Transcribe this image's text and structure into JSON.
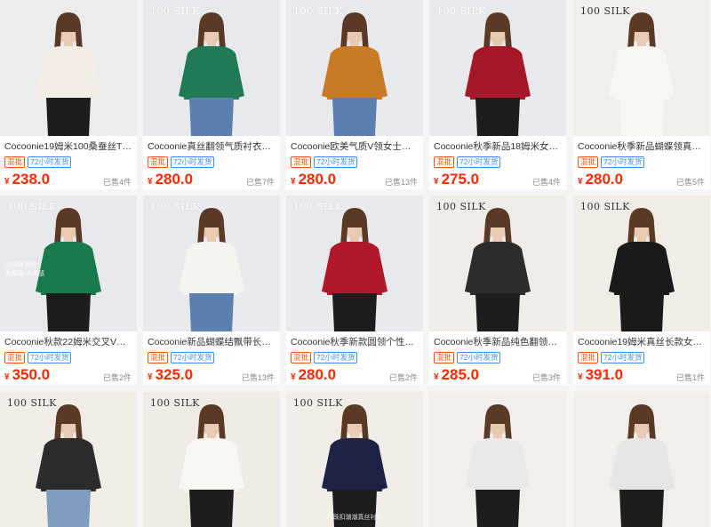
{
  "colors": {
    "price": "#ff2800",
    "mix_badge": "#ff5000",
    "ship_badge": "#3a8df5"
  },
  "products": [
    {
      "brand": "",
      "title": "Cocoonie19姆米100桑蚕丝T恤...",
      "mix": "混批",
      "ship": "72小时发货",
      "currency": "¥",
      "price": "238.0",
      "sold": "已售4件",
      "shirt_color": "#f3ede4",
      "bg": "#ececec",
      "pants": "#1d1d1d"
    },
    {
      "brand": "100 SILK",
      "title": "Cocoonie真丝翻领气质衬衣女批...",
      "mix": "混批",
      "ship": "72小时发货",
      "currency": "¥",
      "price": "280.0",
      "sold": "已售7件",
      "shirt_color": "#1f7a55",
      "bg": "#e8e9ec",
      "pants": "#5b7fae"
    },
    {
      "brand": "100 SILK",
      "title": "Cocoonie欧美气质V领女士衬衣...",
      "mix": "混批",
      "ship": "72小时发货",
      "currency": "¥",
      "price": "280.0",
      "sold": "已售13件",
      "shirt_color": "#c87a25",
      "bg": "#e8e9ec",
      "pants": "#5b7fae"
    },
    {
      "brand": "100 SILK",
      "title": "Cocoonie秋季新品18姆米女士...",
      "mix": "混批",
      "ship": "72小时发货",
      "currency": "¥",
      "price": "275.0",
      "sold": "已售4件",
      "shirt_color": "#a4182a",
      "bg": "#e8e9ec",
      "pants": "#1d1d1d"
    },
    {
      "brand": "100 SILK",
      "title": "Cocoonie秋季新品蝴蝶领真丝衬...",
      "mix": "混批",
      "ship": "72小时发货",
      "currency": "¥",
      "price": "280.0",
      "sold": "已售5件",
      "shirt_color": "#f8f6f2",
      "bg": "#f1efec",
      "pants": "#f8f6f2"
    },
    {
      "brand": "100 SILK",
      "title": "Cocoonie秋款22姆米交叉V领长...",
      "mix": "混批",
      "ship": "72小时发货",
      "currency": "¥",
      "price": "350.0",
      "sold": "已售2件",
      "shirt_color": "#187a4a",
      "bg": "#e8e9ec",
      "pants": "#1d1d1d",
      "overlay": [
        "22姆米真丝",
        "有质感 光泽感"
      ]
    },
    {
      "brand": "100 SILK",
      "title": "Cocoonie新品蝴蝶结飘带长袖真...",
      "mix": "混批",
      "ship": "72小时发货",
      "currency": "¥",
      "price": "325.0",
      "sold": "已售13件",
      "shirt_color": "#f6f4ef",
      "bg": "#e8e9ec",
      "pants": "#5b7fae"
    },
    {
      "brand": "100 SILK",
      "title": "Cocoonie秋季新款圆领个性上衣...",
      "mix": "混批",
      "ship": "72小时发货",
      "currency": "¥",
      "price": "280.0",
      "sold": "已售2件",
      "shirt_color": "#b0182a",
      "bg": "#e8e9ec",
      "pants": "#1d1d1d"
    },
    {
      "brand": "100 SILK",
      "title": "Cocoonie秋季新品纯色翻领长袖...",
      "mix": "混批",
      "ship": "72小时发货",
      "currency": "¥",
      "price": "285.0",
      "sold": "已售3件",
      "shirt_color": "#2c2c2c",
      "bg": "#efebe6",
      "pants": "#1d1d1d"
    },
    {
      "brand": "100 SILK",
      "title": "Cocoonie19姆米真丝长款女士衬...",
      "mix": "混批",
      "ship": "72小时发货",
      "currency": "¥",
      "price": "391.0",
      "sold": "已售1件",
      "shirt_color": "#1a1a1a",
      "bg": "#f1ede6",
      "pants": "#1a1a1a"
    },
    {
      "brand": "100 SILK",
      "shirt_color": "#2c2c2c",
      "bg": "#f1ede6",
      "pants": "#7f9bbd"
    },
    {
      "brand": "100 SILK",
      "shirt_color": "#f8f7f3",
      "bg": "#efebe4",
      "pants": "#1d1d1d"
    },
    {
      "brand": "100 SILK",
      "shirt_color": "#1c2344",
      "bg": "#f1ede6",
      "pants": "#1d1d1d",
      "caption": "珍珠扣潮潮真丝衬衫"
    },
    {
      "brand": "",
      "shirt_color": "#e9e9e9",
      "bg": "#f2efea",
      "pants": "#1d1d1d"
    },
    {
      "brand": "",
      "shirt_color": "#e6e6e6",
      "bg": "#f2efea",
      "pants": "#1d1d1d"
    }
  ]
}
